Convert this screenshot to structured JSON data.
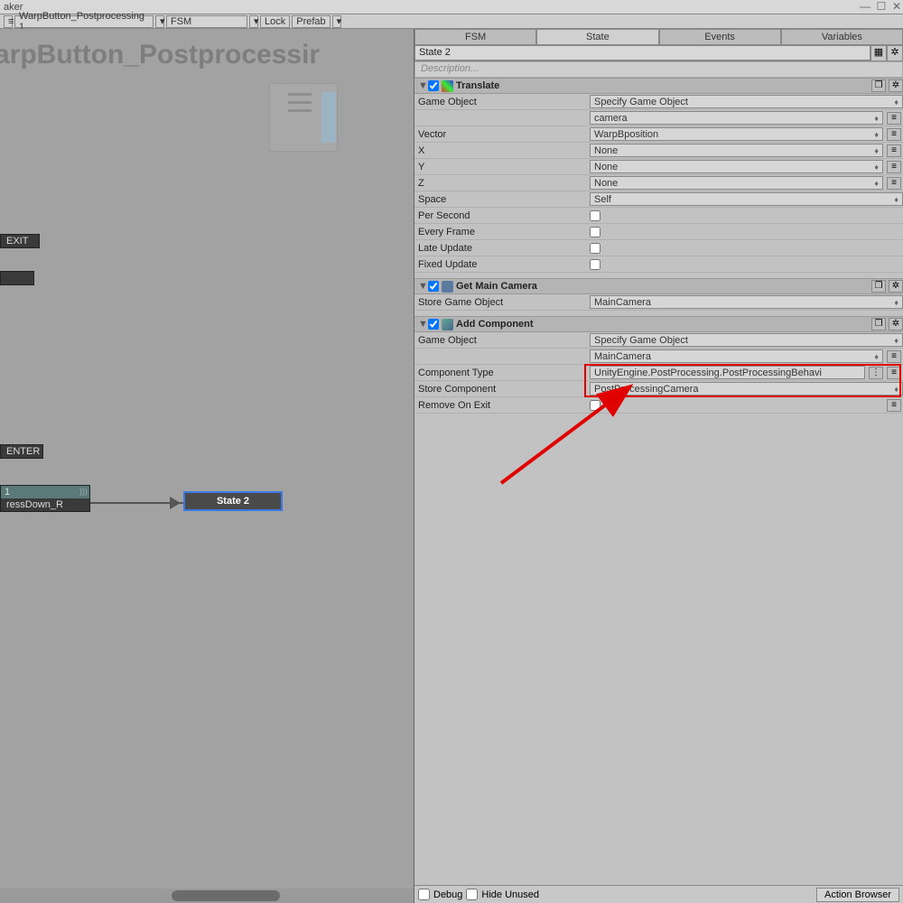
{
  "window_title": "aker",
  "toolbar": {
    "object_name": "WarpButton_Postprocessing 1",
    "fsm_label": "FSM",
    "lock_label": "Lock",
    "prefab_label": "Prefab"
  },
  "canvas": {
    "title": "arpButton_Postprocessir",
    "exit_label": "EXIT",
    "enter_label": "ENTER",
    "state1_num": "1",
    "state1_label": "ressDown_R",
    "state2_label": "State 2"
  },
  "inspector": {
    "tabs": {
      "fsm": "FSM",
      "state": "State",
      "events": "Events",
      "variables": "Variables"
    },
    "state_name": "State 2",
    "description_placeholder": "Description...",
    "translate": {
      "title": "Translate",
      "game_object_label": "Game Object",
      "game_object_value": "Specify Game Object",
      "game_object_target": "camera",
      "vector_label": "Vector",
      "vector_value": "WarpBposition",
      "x_label": "X",
      "x_value": "None",
      "y_label": "Y",
      "y_value": "None",
      "z_label": "Z",
      "z_value": "None",
      "space_label": "Space",
      "space_value": "Self",
      "per_second_label": "Per Second",
      "every_frame_label": "Every Frame",
      "late_update_label": "Late Update",
      "fixed_update_label": "Fixed Update"
    },
    "get_main_camera": {
      "title": "Get Main Camera",
      "store_label": "Store Game Object",
      "store_value": "MainCamera"
    },
    "add_component": {
      "title": "Add Component",
      "game_object_label": "Game Object",
      "game_object_value": "Specify Game Object",
      "game_object_target": "MainCamera",
      "component_type_label": "Component Type",
      "component_type_value": "UnityEngine.PostProcessing.PostProcessingBehavi",
      "store_component_label": "Store Component",
      "store_component_value": "PostProcessingCamera",
      "remove_on_exit_label": "Remove On Exit"
    },
    "bottom": {
      "debug_label": "Debug",
      "hide_unused_label": "Hide Unused",
      "action_browser_label": "Action Browser"
    }
  }
}
